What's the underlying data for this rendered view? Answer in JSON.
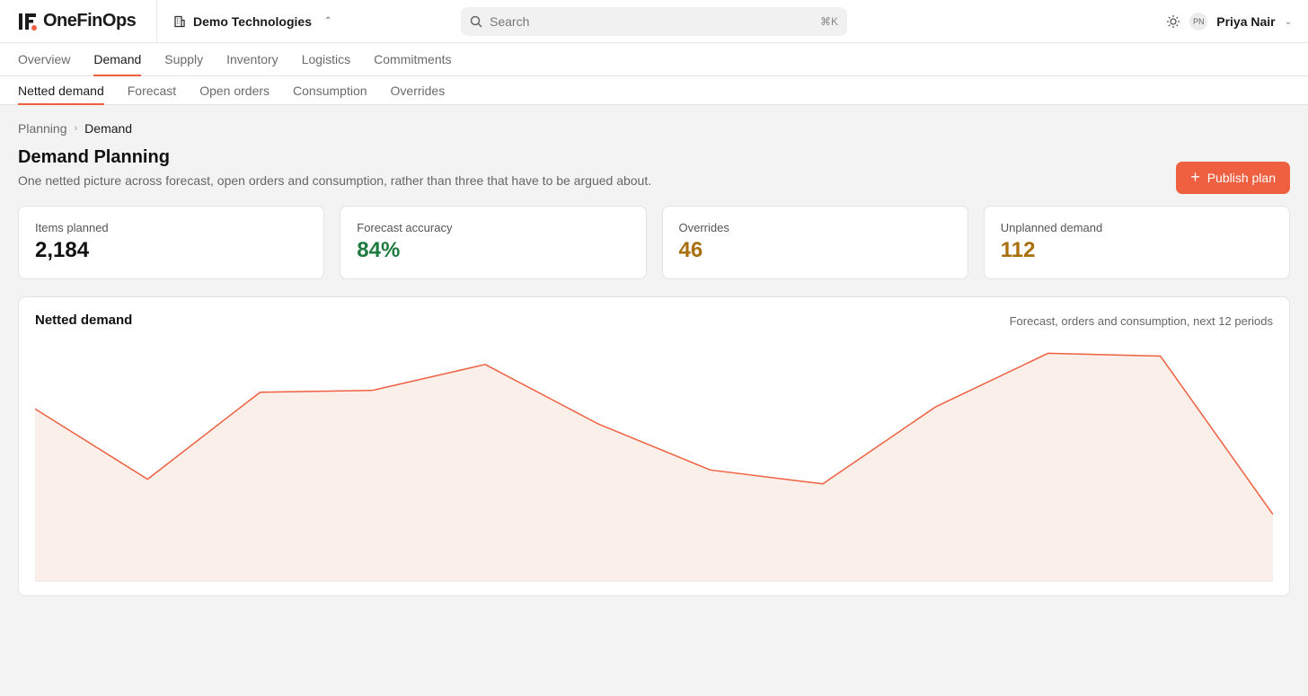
{
  "app": {
    "name": "OneFinOps"
  },
  "org": {
    "name": "Demo Technologies"
  },
  "search": {
    "placeholder": "Search",
    "shortcut": "⌘K"
  },
  "user": {
    "initials": "PN",
    "name": "Priya Nair"
  },
  "nav": {
    "primary": [
      {
        "label": "Overview",
        "active": false
      },
      {
        "label": "Demand",
        "active": true
      },
      {
        "label": "Supply",
        "active": false
      },
      {
        "label": "Inventory",
        "active": false
      },
      {
        "label": "Logistics",
        "active": false
      },
      {
        "label": "Commitments",
        "active": false
      }
    ],
    "secondary": [
      {
        "label": "Netted demand",
        "active": true
      },
      {
        "label": "Forecast",
        "active": false
      },
      {
        "label": "Open orders",
        "active": false
      },
      {
        "label": "Consumption",
        "active": false
      },
      {
        "label": "Overrides",
        "active": false
      }
    ]
  },
  "breadcrumb": {
    "parent": "Planning",
    "current": "Demand"
  },
  "page": {
    "title": "Demand Planning",
    "subtitle": "One netted picture across forecast, open orders and consumption, rather than three that have to be argued about.",
    "publish_label": "Publish plan"
  },
  "kpis": [
    {
      "label": "Items planned",
      "value": "2,184",
      "tone": "default"
    },
    {
      "label": "Forecast accuracy",
      "value": "84%",
      "tone": "green"
    },
    {
      "label": "Overrides",
      "value": "46",
      "tone": "amber"
    },
    {
      "label": "Unplanned demand",
      "value": "112",
      "tone": "amber"
    }
  ],
  "colors": {
    "accent": "#ee6040",
    "area_fill": "#fbefea",
    "positive": "#1e7a3f",
    "warning": "#a86f0c"
  },
  "chart": {
    "title": "Netted demand",
    "caption": "Forecast, orders and consumption, next 12 periods"
  },
  "chart_data": {
    "type": "area",
    "title": "Netted demand",
    "subtitle": "Forecast, orders and consumption, next 12 periods",
    "x": [
      1,
      2,
      3,
      4,
      5,
      6,
      7,
      8,
      9,
      10,
      11,
      12
    ],
    "values": [
      186,
      110,
      204,
      206,
      234,
      170,
      120,
      105,
      188,
      246,
      243,
      72
    ],
    "ylim": [
      0,
      260
    ],
    "grid": false,
    "legend": "none"
  }
}
